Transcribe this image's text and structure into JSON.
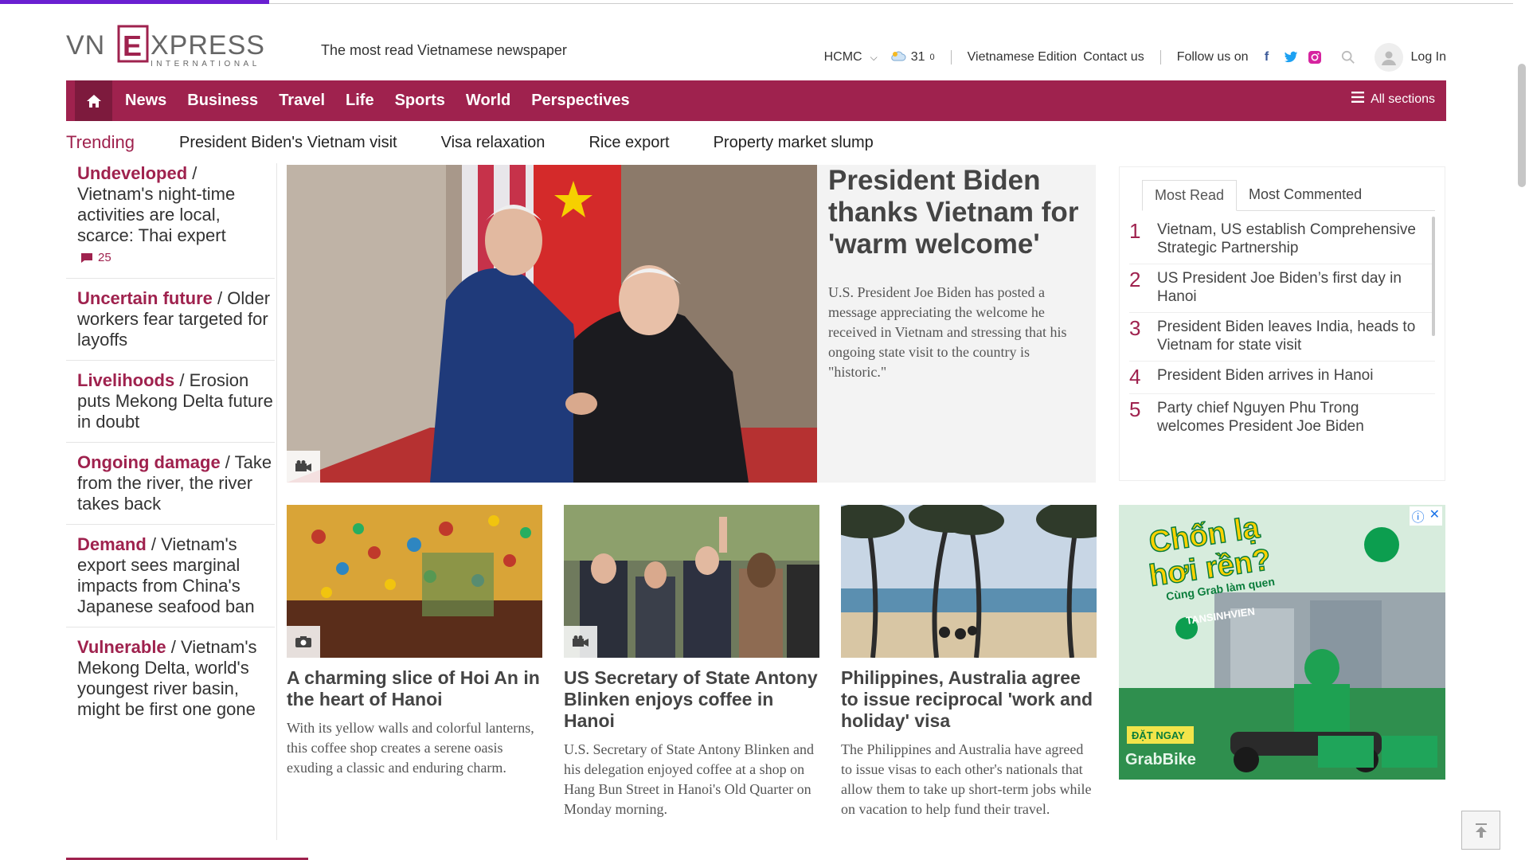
{
  "header": {
    "logo_text_vn": "VN",
    "logo_text_e": "E",
    "logo_text_xpress": "XPRESS",
    "logo_sub": "INTERNATIONAL",
    "tagline": "The most read Vietnamese newspaper",
    "city": "HCMC",
    "temperature": "31",
    "degree": "0",
    "vn_edition": "Vietnamese Edition",
    "contact": "Contact us",
    "follow": "Follow us on",
    "login": "Log In"
  },
  "nav": {
    "items": [
      "News",
      "Business",
      "Travel",
      "Life",
      "Sports",
      "World",
      "Perspectives"
    ],
    "all_sections": "All sections"
  },
  "trending": {
    "label": "Trending",
    "items": [
      "President Biden's Vietnam visit",
      "Visa relaxation",
      "Rice export",
      "Property market slump"
    ]
  },
  "left_stories": [
    {
      "kw": "Undeveloped",
      "text": "Vietnam's night-time activities are local, scarce: Thai expert",
      "comments": "25"
    },
    {
      "kw": "Uncertain future",
      "text": "Older workers fear targeted for layoffs"
    },
    {
      "kw": "Livelihoods",
      "text": "Erosion puts Mekong Delta future in doubt"
    },
    {
      "kw": "Ongoing damage",
      "text": "Take from the river, the river takes back"
    },
    {
      "kw": "Demand",
      "text": "Vietnam's export sees marginal impacts from China's Japanese seafood ban"
    },
    {
      "kw": "Vulnerable",
      "text": "Vietnam's Mekong Delta, world's youngest river basin, might be first one gone"
    }
  ],
  "hero": {
    "title": "President Biden thanks Vietnam for 'warm welcome'",
    "desc": "U.S. President Joe Biden has posted a message appreciating the welcome he received in Vietnam and stressing that his ongoing state visit to the country is \"historic.\""
  },
  "most_read": {
    "tabs": [
      "Most Read",
      "Most Commented"
    ],
    "items": [
      {
        "n": "1",
        "t": "Vietnam, US establish Comprehensive Strategic Partnership"
      },
      {
        "n": "2",
        "t": "US President Joe Biden’s first day in Hanoi"
      },
      {
        "n": "3",
        "t": "President Biden leaves India, heads to Vietnam for state visit"
      },
      {
        "n": "4",
        "t": "President Biden arrives in Hanoi"
      },
      {
        "n": "5",
        "t": "Party chief Nguyen Phu Trong welcomes President Joe Biden"
      }
    ]
  },
  "cards": [
    {
      "title": "A charming slice of Hoi An in the heart of Hanoi",
      "desc": "With its yellow walls and colorful lanterns, this coffee shop creates a serene oasis exuding a classic and enduring charm."
    },
    {
      "title": "US Secretary of State Antony Blinken enjoys coffee in Hanoi",
      "desc": "U.S. Secretary of State Antony Blinken and his delegation enjoyed coffee at a shop on Hang Bun Street in Hanoi's Old Quarter on Monday morning."
    },
    {
      "title": "Philippines, Australia agree to issue reciprocal 'work and holiday' visa",
      "desc": "The Philippines and Australia have agreed to issue visas to each other's nationals that allow them to take up short-term jobs while on vacation to help fund their travel."
    }
  ],
  "ad": {
    "headline1": "Chốn lạ",
    "headline2": "hơi rền?",
    "sub": "Cùng Grab làm quen",
    "sign": "TANSINHVIEN",
    "cta": "ĐẶT NGAY",
    "brand": "GrabBike"
  },
  "colors": {
    "brand": "#9f224e",
    "brand_dark": "#7d1a3d"
  }
}
